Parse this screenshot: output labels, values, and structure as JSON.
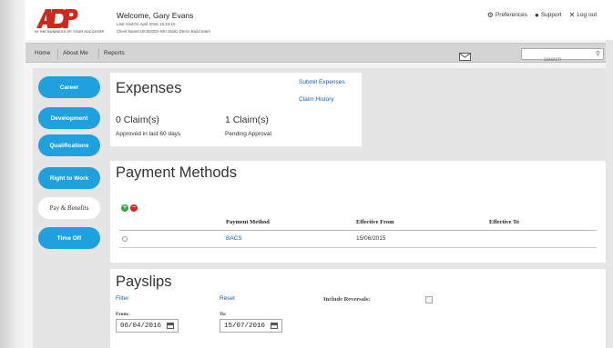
{
  "header": {
    "tagline": "IN THE BUSINESS OF YOUR SUCCESS®",
    "welcome": "Welcome, Gary Evans",
    "last_visit": "Last Visit:01 April 2016 15:24:16",
    "client": "Client Name:UKSD002-SEI Static Demo Build team",
    "preferences": "Preferences",
    "support": "Support",
    "logout": "Log out"
  },
  "nav": {
    "home": "Home",
    "about": "About Me",
    "reports": "Reports",
    "search_placeholder": "Search"
  },
  "sidebar": {
    "items": [
      {
        "label": "Career"
      },
      {
        "label": "Development"
      },
      {
        "label": "Qualifications"
      },
      {
        "label": "Right to Work"
      },
      {
        "label": "Pay & Benefits"
      },
      {
        "label": "Time Off"
      }
    ]
  },
  "expenses": {
    "title": "Expenses",
    "submit_link": "Submit Expenses",
    "history_link": "Claim History",
    "approved_count": "0 Claim(s)",
    "approved_label": "Approved in last 60 days",
    "pending_count": "1 Claim(s)",
    "pending_label": "Pending Approval"
  },
  "payment_methods": {
    "title": "Payment Methods",
    "columns": [
      "Payment Method",
      "Effective From",
      "Effective To"
    ],
    "rows": [
      {
        "method": "BACS",
        "from": "15/06/2015",
        "to": ""
      }
    ]
  },
  "payslips": {
    "title": "Payslips",
    "filter_link": "Filter",
    "reset_link": "Reset",
    "include_reversals": "Include Reversals:",
    "from_label": "From:",
    "from_value": "06/04/2016",
    "to_label": "To:",
    "to_value": "15/07/2016"
  },
  "colors": {
    "accent": "#1fa0df",
    "logo_red": "#d0271d",
    "link": "#1a5ea8"
  }
}
